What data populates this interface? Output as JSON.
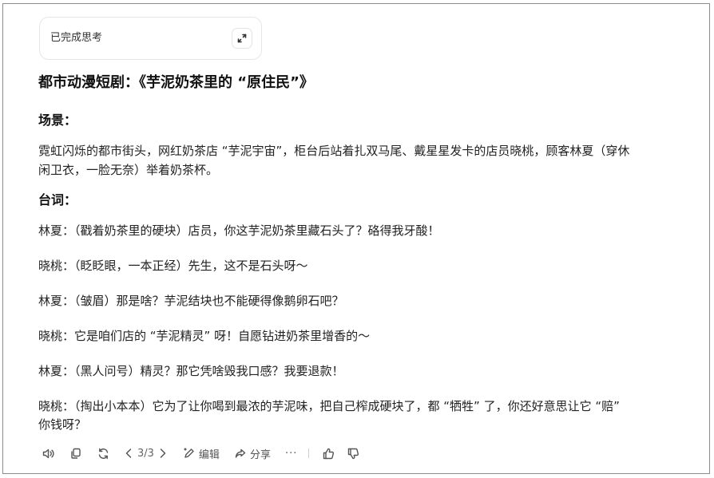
{
  "thinking": {
    "label": "已完成思考"
  },
  "title": "都市动漫短剧：《芋泥奶茶里的 “原住民”》",
  "scene": {
    "heading": "场景：",
    "lines": [
      "霓虹闪烁的都市街头，网红奶茶店 “芋泥宇宙”，柜台后站着扎双马尾、戴星星发卡的店员晓桃，顾客林夏（穿休",
      "闲卫衣，一脸无奈）举着奶茶杯。"
    ]
  },
  "dialogue": {
    "heading": "台词：",
    "lines": [
      "林夏：（戳着奶茶里的硬块）店员，你这芋泥奶茶里藏石头了？硌得我牙酸！",
      "晓桃：（眨眨眼，一本正经）先生，这不是石头呀～",
      "林夏：（皱眉）那是啥？芋泥结块也不能硬得像鹅卵石吧？",
      "晓桃：它是咱们店的 “芋泥精灵” 呀！自愿钻进奶茶里增香的～",
      "林夏：（黑人问号）精灵？那它凭啥毁我口感？我要退款！",
      "晓桃：（掏出小本本）它为了让你喝到最浓的芋泥味，把自己榨成硬块了，都 “牺牲” 了，你还好意思让它 “赔”"
    ],
    "last_cont": "你钱呀？"
  },
  "toolbar": {
    "page": "3/3",
    "edit": "编辑",
    "share": "分享",
    "more": "···"
  }
}
